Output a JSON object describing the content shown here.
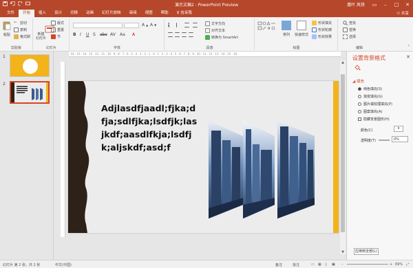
{
  "titlebar": {
    "doc_title": "演示文稿2 - PowerPoint Preview",
    "user": "惠叶 风铁",
    "share": "共享"
  },
  "menu": {
    "tabs": [
      "文件",
      "开始",
      "插入",
      "设计",
      "切换",
      "动画",
      "幻灯片放映",
      "审阅",
      "视图",
      "帮助",
      "♀ 告诉我"
    ]
  },
  "ribbon": {
    "clipboard": {
      "paste": "粘贴",
      "cut": "剪切",
      "copy": "复制",
      "format": "格式刷",
      "label": "剪贴板"
    },
    "slides": {
      "new": "新建\n幻灯片",
      "layout": "版式",
      "reset": "重置",
      "section": "节",
      "label": "幻灯片"
    },
    "font": {
      "label": "字体",
      "size_value": ""
    },
    "paragraph": {
      "label": "段落",
      "text_dir": "文字方向",
      "align": "对齐文本",
      "smartart": "转换为 SmartArt"
    },
    "drawing": {
      "label": "绘图",
      "arrange": "排列",
      "quick_styles": "快速样式",
      "fill": "形状填充",
      "outline": "形状轮廓",
      "effects": "形状效果"
    },
    "editing": {
      "label": "编辑",
      "find": "查找",
      "replace": "替换",
      "select": "选择"
    }
  },
  "thumbnails": [
    {
      "num": "1",
      "selected": false
    },
    {
      "num": "2",
      "selected": true
    }
  ],
  "slide": {
    "text": "Adjlasdfjaadl;fjka;dfja;sdlfjka;lsdfjk;lasjkdf;aasdlfkja;lsdfjk;aljskdf;asd;f",
    "accent_left": "#2e2118",
    "accent_right": "#f2b31b"
  },
  "pane": {
    "title": "设置背景格式",
    "section": "填充",
    "options": [
      "纯色填充(S)",
      "渐变填充(G)",
      "图片或纹理填充(P)",
      "图案填充(A)"
    ],
    "hide_bg": "隐藏背景图形(H)",
    "color_label": "颜色(C)",
    "transparency_label": "透明度(T)",
    "transparency_value": "0%",
    "apply_all": "应用到全部(L)"
  },
  "status": {
    "slide_info": "幻灯片 第 2 张，共 2 张",
    "language": "中文(中国)",
    "notes": "备注",
    "comments": "批注",
    "zoom": "69%"
  },
  "colors": {
    "brand": "#b7472a",
    "accent": "#d24726"
  }
}
